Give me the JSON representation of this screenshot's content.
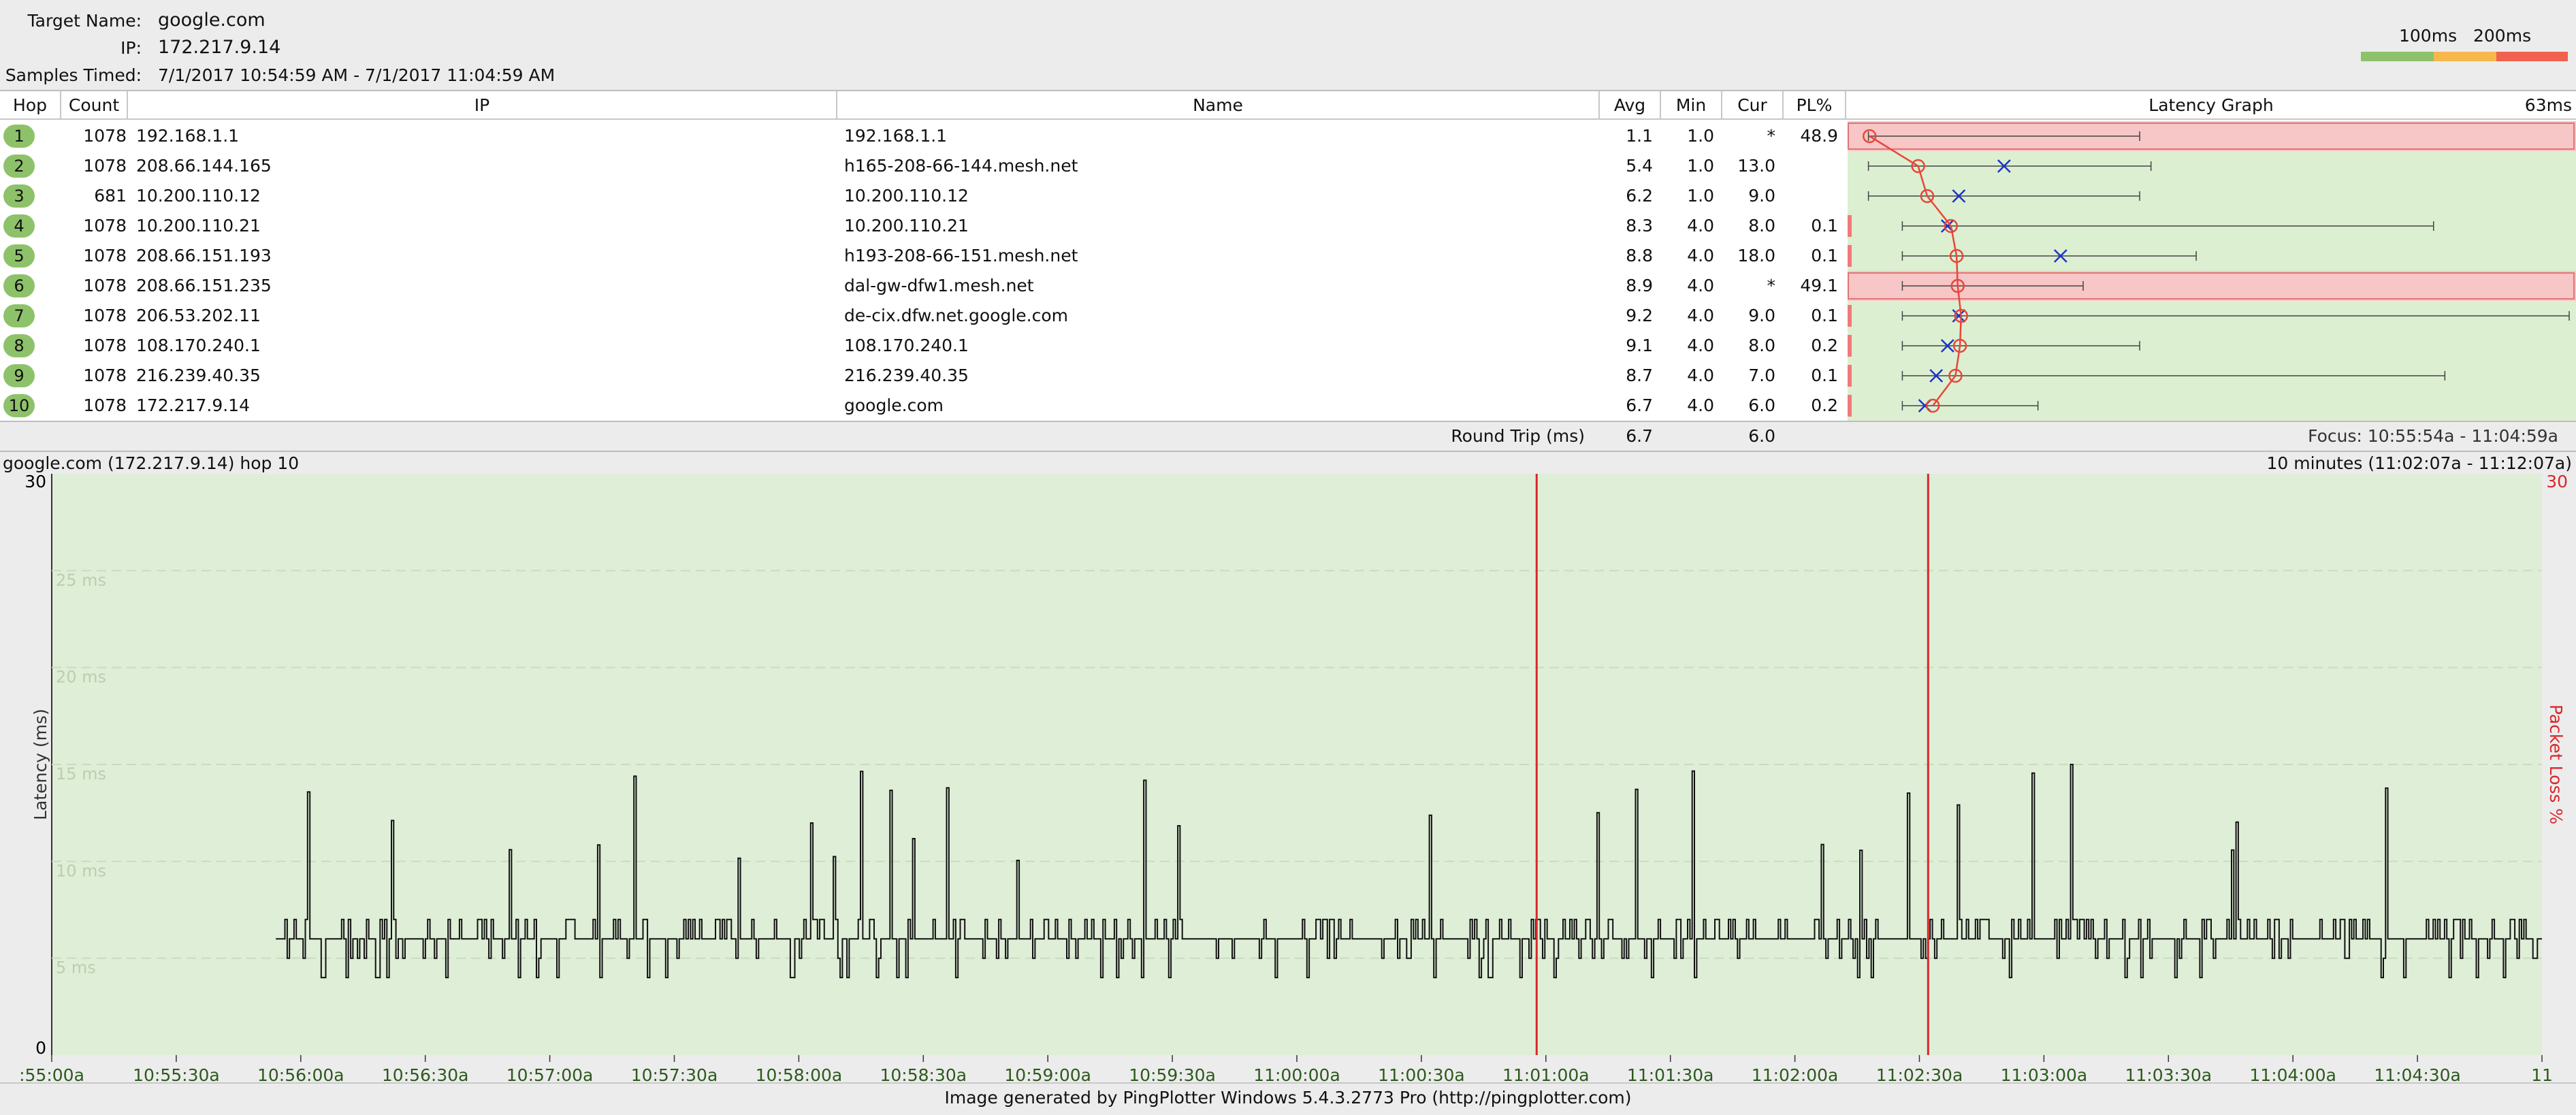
{
  "header": {
    "target_label": "Target Name:",
    "target_value": "google.com",
    "ip_label": "IP:",
    "ip_value": "172.217.9.14",
    "samples_label": "Samples Timed:",
    "samples_value": "7/1/2017 10:54:59 AM - 7/1/2017 11:04:59 AM",
    "legend_100": "100ms",
    "legend_200": "200ms",
    "legend_colors": [
      "#8ec26a",
      "#f7b84b",
      "#f0624e"
    ]
  },
  "table": {
    "columns": [
      "Hop",
      "Count",
      "IP",
      "Name",
      "Avg",
      "Min",
      "Cur",
      "PL%",
      "Latency Graph"
    ],
    "scale_label": "63ms",
    "scale_max_ms": 63,
    "rows": [
      {
        "hop": "1",
        "count": "1078",
        "ip": "192.168.1.1",
        "name": "192.168.1.1",
        "avg": "1.1",
        "min": "1.0",
        "cur": "*",
        "pl": "48.9",
        "avg_ms": 1.1,
        "cur_ms": null,
        "max_ms": 25,
        "pl_frac": 0.489
      },
      {
        "hop": "2",
        "count": "1078",
        "ip": "208.66.144.165",
        "name": "h165-208-66-144.mesh.net",
        "avg": "5.4",
        "min": "1.0",
        "cur": "13.0",
        "pl": "",
        "avg_ms": 5.4,
        "cur_ms": 13.0,
        "max_ms": 26,
        "pl_frac": 0
      },
      {
        "hop": "3",
        "count": "681",
        "ip": "10.200.110.12",
        "name": "10.200.110.12",
        "avg": "6.2",
        "min": "1.0",
        "cur": "9.0",
        "pl": "",
        "avg_ms": 6.2,
        "cur_ms": 9.0,
        "max_ms": 25,
        "pl_frac": 0
      },
      {
        "hop": "4",
        "count": "1078",
        "ip": "10.200.110.21",
        "name": "10.200.110.21",
        "avg": "8.3",
        "min": "4.0",
        "cur": "8.0",
        "pl": "0.1",
        "avg_ms": 8.3,
        "cur_ms": 8.0,
        "max_ms": 51,
        "pl_frac": 0.001
      },
      {
        "hop": "5",
        "count": "1078",
        "ip": "208.66.151.193",
        "name": "h193-208-66-151.mesh.net",
        "avg": "8.8",
        "min": "4.0",
        "cur": "18.0",
        "pl": "0.1",
        "avg_ms": 8.8,
        "cur_ms": 18.0,
        "max_ms": 30,
        "pl_frac": 0.001
      },
      {
        "hop": "6",
        "count": "1078",
        "ip": "208.66.151.235",
        "name": "dal-gw-dfw1.mesh.net",
        "avg": "8.9",
        "min": "4.0",
        "cur": "*",
        "pl": "49.1",
        "avg_ms": 8.9,
        "cur_ms": null,
        "max_ms": 20,
        "pl_frac": 0.491
      },
      {
        "hop": "7",
        "count": "1078",
        "ip": "206.53.202.11",
        "name": "de-cix.dfw.net.google.com",
        "avg": "9.2",
        "min": "4.0",
        "cur": "9.0",
        "pl": "0.1",
        "avg_ms": 9.2,
        "cur_ms": 9.0,
        "max_ms": 63,
        "pl_frac": 0.001
      },
      {
        "hop": "8",
        "count": "1078",
        "ip": "108.170.240.1",
        "name": "108.170.240.1",
        "avg": "9.1",
        "min": "4.0",
        "cur": "8.0",
        "pl": "0.2",
        "avg_ms": 9.1,
        "cur_ms": 8.0,
        "max_ms": 25,
        "pl_frac": 0.002
      },
      {
        "hop": "9",
        "count": "1078",
        "ip": "216.239.40.35",
        "name": "216.239.40.35",
        "avg": "8.7",
        "min": "4.0",
        "cur": "7.0",
        "pl": "0.1",
        "avg_ms": 8.7,
        "cur_ms": 7.0,
        "max_ms": 52,
        "pl_frac": 0.001
      },
      {
        "hop": "10",
        "count": "1078",
        "ip": "172.217.9.14",
        "name": "google.com",
        "avg": "6.7",
        "min": "4.0",
        "cur": "6.0",
        "pl": "0.2",
        "avg_ms": 6.7,
        "cur_ms": 6.0,
        "max_ms": 16,
        "pl_frac": 0.002
      }
    ]
  },
  "round_trip": {
    "label": "Round Trip (ms)",
    "avg": "6.7",
    "cur": "6.0",
    "focus": "Focus: 10:55:54a - 11:04:59a"
  },
  "graph": {
    "title_left": "google.com (172.217.9.14) hop 10",
    "title_right": "10 minutes (11:02:07a - 11:12:07a)",
    "y_axis_label": "Latency (ms)",
    "y_right_label": "Packet Loss %",
    "y_max_label": "30",
    "y_min_label": "0",
    "y_right_max": "30",
    "gridlines": [
      "25 ms",
      "20 ms",
      "15 ms",
      "10 ms",
      "5 ms"
    ],
    "x_ticks": [
      ":55:00a",
      "10:55:30a",
      "10:56:00a",
      "10:56:30a",
      "10:57:00a",
      "10:57:30a",
      "10:58:00a",
      "10:58:30a",
      "10:59:00a",
      "10:59:30a",
      "11:00:00a",
      "11:00:30a",
      "11:01:00a",
      "11:01:30a",
      "11:02:00a",
      "11:02:30a",
      "11:03:00a",
      "11:03:30a",
      "11:04:00a",
      "11:04:30a",
      "11"
    ]
  },
  "chart_data": {
    "type": "line",
    "title": "google.com (172.217.9.14) hop 10",
    "ylabel": "Latency (ms)",
    "y2label": "Packet Loss %",
    "ylim": [
      0,
      30
    ],
    "y_baseline_ms": 6,
    "x_range": [
      "10:54:59a",
      "11:04:59a"
    ],
    "data_start": "10:55:53a",
    "packet_loss_events": [
      "11:00:46a",
      "11:02:16a"
    ],
    "series": [
      {
        "values_summary": {
          "typical_ms": 6,
          "min_ms": 4,
          "max_ms": 16
        }
      }
    ],
    "grid": true
  },
  "colors": {
    "graph_bg": "#dfeed7",
    "loss_line": "#d9262b",
    "loss_row": "#f7c6c6",
    "green_cell": "#dcefd1",
    "tick_text": "#2c5a1c"
  },
  "footer": {
    "text": "Image generated by PingPlotter Windows 5.4.3.2773 Pro (http://pingplotter.com)"
  }
}
